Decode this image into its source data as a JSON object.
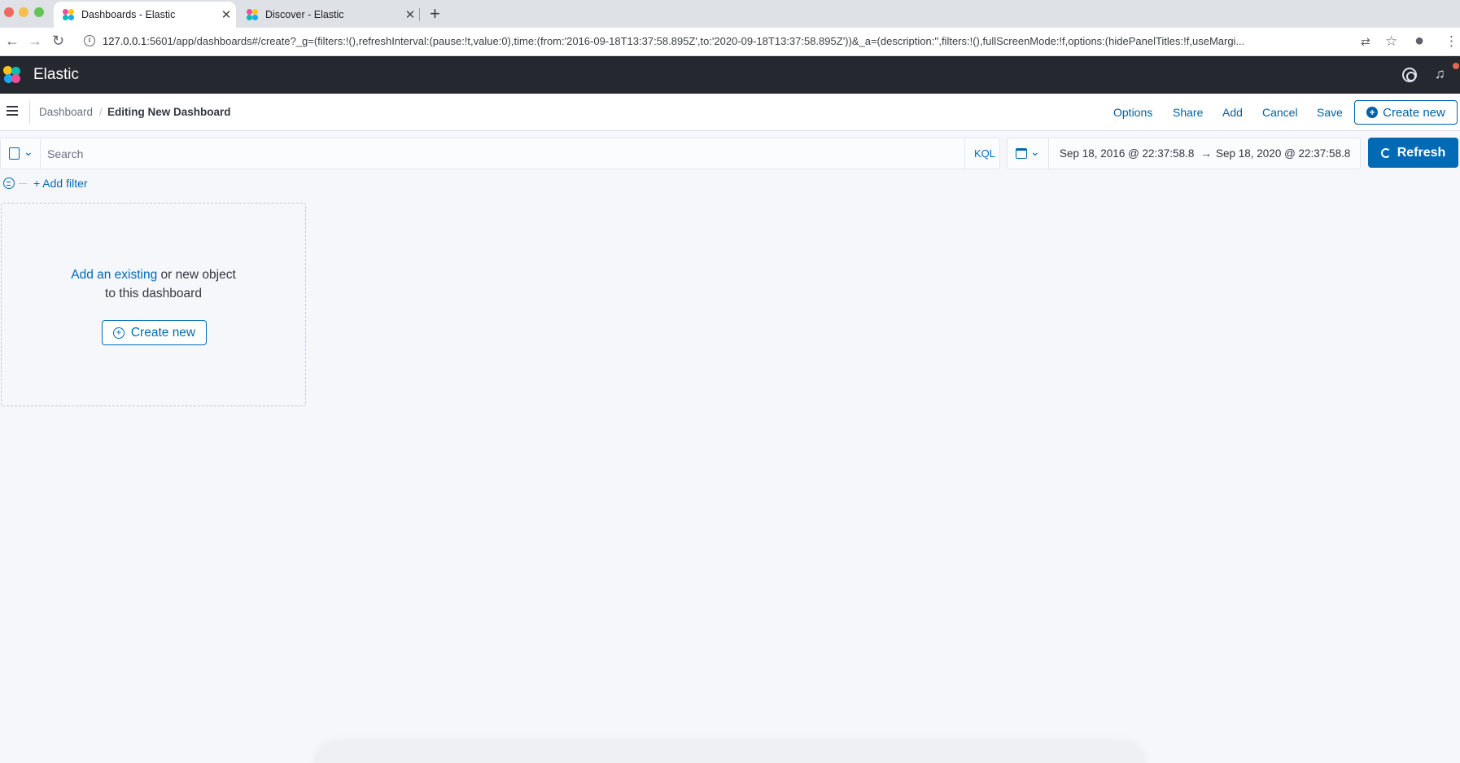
{
  "browser": {
    "tabs": [
      {
        "title": "Dashboards - Elastic",
        "active": true
      },
      {
        "title": "Discover - Elastic",
        "active": false
      }
    ],
    "close_glyph": "✕",
    "new_tab_glyph": "+",
    "url_host": "127.0.0.1",
    "url_rest": ":5601/app/dashboards#/create?_g=(filters:!(),refreshInterval:(pause:!t,value:0),time:(from:'2016-09-18T13:37:58.895Z',to:'2020-09-18T13:37:58.895Z'))&_a=(description:'',filters:!(),fullScreenMode:!f,options:(hidePanelTitles:!f,useMargi..."
  },
  "header": {
    "title": "Elastic",
    "logo_colors": [
      "#f04e98",
      "#fec514",
      "#00bfb3",
      "#1ba9f5"
    ]
  },
  "breadcrumbs": {
    "first": "Dashboard",
    "separator": "/",
    "current": "Editing New Dashboard"
  },
  "top_menu": {
    "options": "Options",
    "share": "Share",
    "add": "Add",
    "cancel": "Cancel",
    "save": "Save",
    "create_new": "Create new"
  },
  "query_bar": {
    "placeholder": "Search",
    "language": "KQL"
  },
  "date_picker": {
    "start": "Sep 18, 2016 @ 22:37:58.8",
    "arrow": "→",
    "end": "Sep 18, 2020 @ 22:37:58.8"
  },
  "refresh_label": "Refresh",
  "filters": {
    "add_filter": "+ Add filter"
  },
  "empty_panel": {
    "link_text": "Add an existing",
    "text_after_link": " or new object",
    "line2": "to this dashboard",
    "create_new": "Create new"
  },
  "colors": {
    "accent": "#006bb4",
    "header_bg": "#25282f",
    "page_bg": "#f5f7fa"
  }
}
